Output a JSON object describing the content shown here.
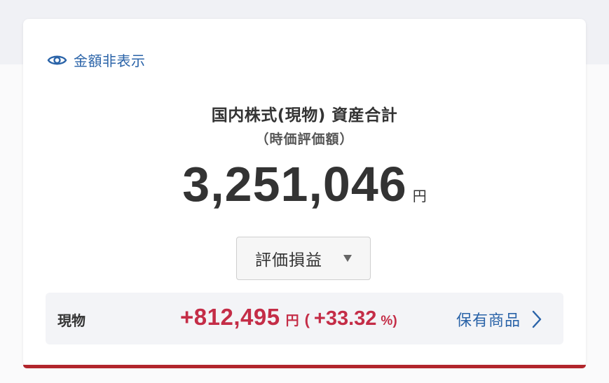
{
  "hide_toggle": {
    "label": "金額非表示",
    "icon": "eye-icon"
  },
  "summary": {
    "title": "国内株式(現物) 資産合計",
    "subtitle": "（時価評価額）",
    "total_amount": "3,251,046",
    "total_unit": "円"
  },
  "dropdown": {
    "selected": "評価損益",
    "icon": "caret-down-icon"
  },
  "row": {
    "label": "現物",
    "gain_amount": "+812,495",
    "gain_unit": "円",
    "paren_open": "(",
    "gain_percent": "+33.32",
    "percent_unit": "%)",
    "link_label": "保有商品",
    "link_icon": "chevron-right-icon"
  },
  "colors": {
    "accent_blue": "#2a63a8",
    "gain_red": "#c42d47",
    "card_bottom_border": "#b2262c"
  }
}
